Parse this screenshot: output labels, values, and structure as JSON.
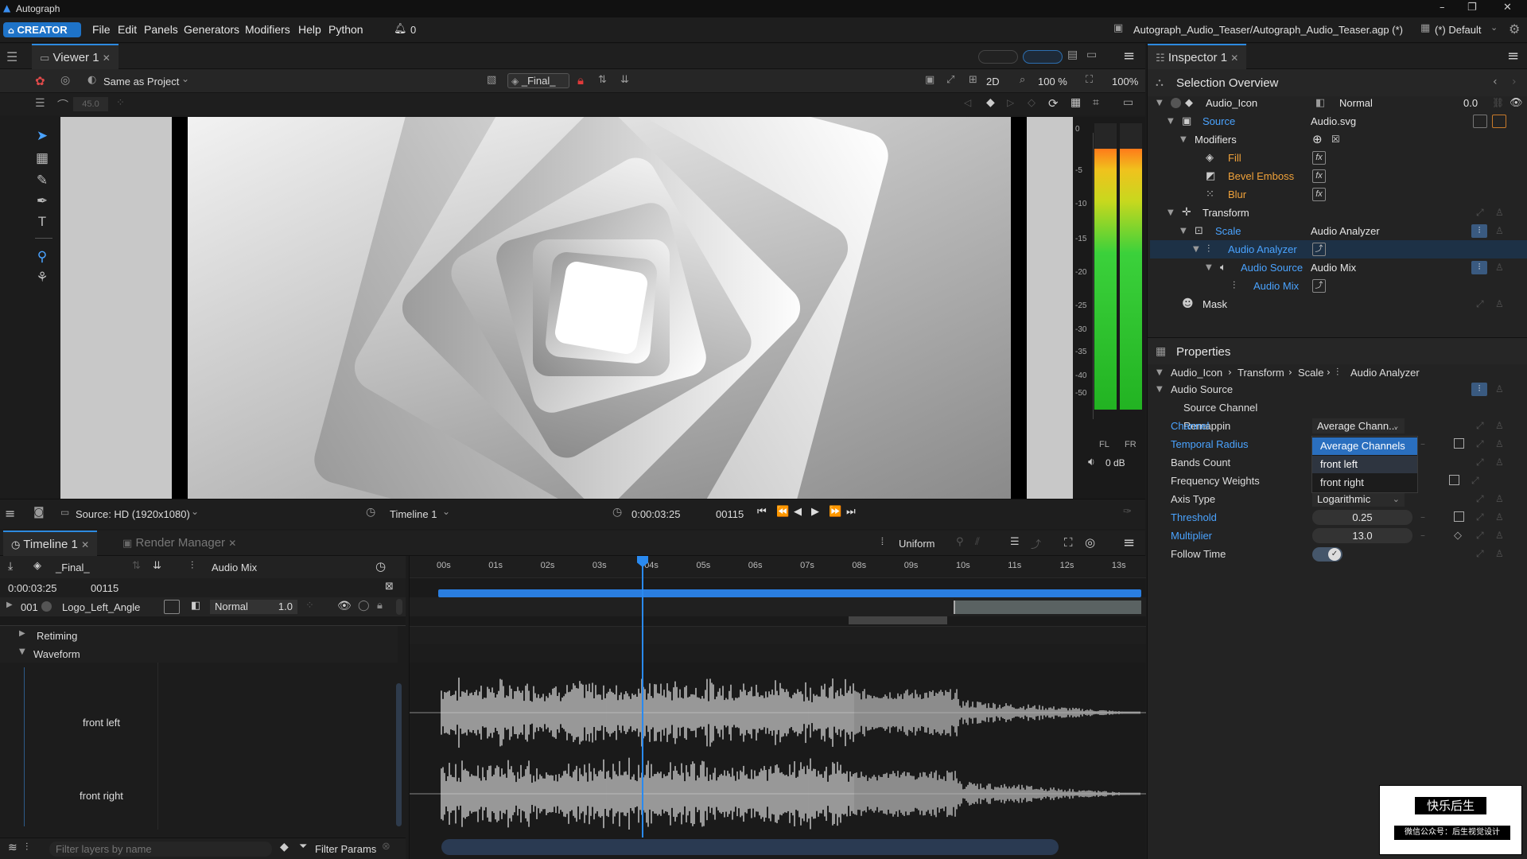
{
  "app": {
    "title": "Autograph",
    "edition": "CREATOR",
    "project_path": "Autograph_Audio_Teaser/Autograph_Audio_Teaser.agp (*)",
    "workspace": "(*) Default",
    "notifications": "0"
  },
  "menu": [
    "File",
    "Edit",
    "Panels",
    "Generators",
    "Modifiers",
    "Help",
    "Python"
  ],
  "viewer": {
    "tab": "Viewer 1",
    "color_space": "Same as Project",
    "comp_name": "_Final_",
    "mode": "2D",
    "zoom": "100 %",
    "resolution_pct": "100%",
    "rotation_value": "45.0",
    "source": "Source: HD (1920x1080)",
    "timeline": "Timeline 1",
    "timecode": "0:00:03:25",
    "frame": "00115",
    "meter_labels": [
      "0",
      "-5",
      "-10",
      "-15",
      "-20",
      "-25",
      "-30",
      "-35",
      "-40",
      "-50"
    ],
    "meter_channels": [
      "FL",
      "FR"
    ],
    "volume": "0 dB",
    "meter_levels": {
      "left": 0.91,
      "right": 0.91
    }
  },
  "inspector": {
    "tab": "Inspector 1",
    "overview_title": "Selection Overview",
    "tree": [
      {
        "label": "Audio_Icon",
        "value": "Normal",
        "extra": "0.0"
      },
      {
        "label": "Source",
        "value": "Audio.svg"
      },
      {
        "label": "Modifiers",
        "value": ""
      },
      {
        "label": "Fill",
        "value": ""
      },
      {
        "label": "Bevel Emboss",
        "value": ""
      },
      {
        "label": "Blur",
        "value": ""
      },
      {
        "label": "Transform",
        "value": ""
      },
      {
        "label": "Scale",
        "value": "Audio Analyzer"
      },
      {
        "label": "Audio Analyzer",
        "value": ""
      },
      {
        "label": "Audio Source",
        "value": "Audio Mix"
      },
      {
        "label": "Audio Mix",
        "value": ""
      },
      {
        "label": "Mask",
        "value": ""
      }
    ],
    "properties_title": "Properties",
    "breadcrumb": [
      "Audio_Icon",
      "Transform",
      "Scale",
      "Audio Analyzer"
    ],
    "section": "Audio Source",
    "subsection": "Source Channel Remappin",
    "props": [
      {
        "label": "Channel",
        "value": "Average Chann..."
      },
      {
        "label": "Temporal Radius",
        "value": ""
      },
      {
        "label": "Bands Count",
        "value": ""
      },
      {
        "label": "Frequency Weights",
        "value": ""
      },
      {
        "label": "Axis Type",
        "value": "Logarithmic"
      },
      {
        "label": "Threshold",
        "value": "0.25"
      },
      {
        "label": "Multiplier",
        "value": "13.0"
      },
      {
        "label": "Follow Time",
        "value": ""
      }
    ],
    "dropdown_options": [
      "Average Channels",
      "front left",
      "front right"
    ]
  },
  "timeline": {
    "tab": "Timeline 1",
    "tab2": "Render Manager",
    "snap_mode": "Uniform",
    "comp_name": "_Final_",
    "audio_track": "Audio Mix",
    "timecode": "0:00:03:25",
    "frame": "00115",
    "ruler": [
      "00s",
      "01s",
      "02s",
      "03s",
      "04s",
      "05s",
      "06s",
      "07s",
      "08s",
      "09s",
      "10s",
      "11s",
      "12s",
      "13s"
    ],
    "layer": {
      "index": "001",
      "name": "Logo_Left_Angle",
      "blend": "Normal",
      "opacity": "1.0"
    },
    "groups": [
      "Retiming",
      "Waveform"
    ],
    "channels": [
      "front left",
      "front right"
    ],
    "filter_placeholder": "Filter layers by name",
    "filter_params": "Filter Params"
  },
  "watermark": {
    "line1": "快乐后生",
    "line2": "微信公众号：后生视觉设计"
  }
}
